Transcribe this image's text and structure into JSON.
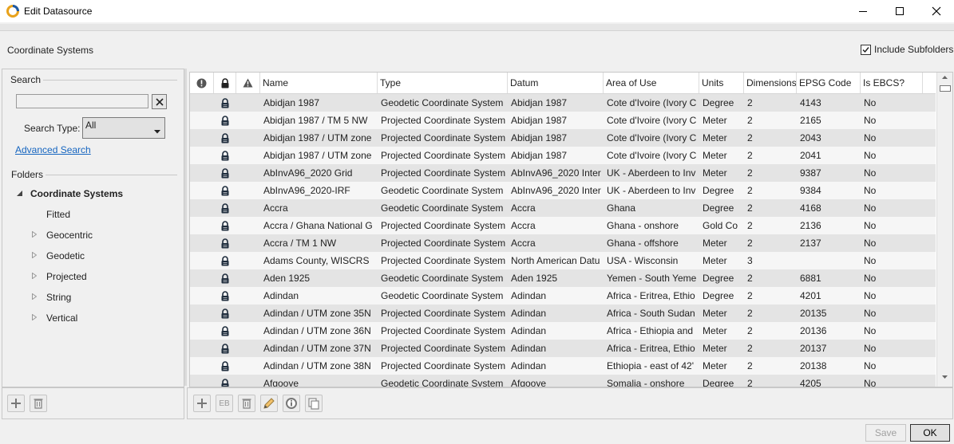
{
  "window": {
    "title": "Edit Datasource",
    "controls": {
      "minimize": "minimize-icon",
      "maximize": "maximize-icon",
      "close": "close-icon"
    }
  },
  "header": {
    "section_title": "Coordinate Systems",
    "include_subfolders": {
      "label": "Include Subfolders",
      "checked": true
    }
  },
  "search": {
    "legend": "Search",
    "input_value": "",
    "search_type_label": "Search Type:",
    "search_type_value": "All",
    "advanced_link": "Advanced Search"
  },
  "folders": {
    "legend": "Folders",
    "root": "Coordinate Systems",
    "children": [
      {
        "label": "Fitted",
        "expandable": false
      },
      {
        "label": "Geocentric",
        "expandable": true
      },
      {
        "label": "Geodetic",
        "expandable": true
      },
      {
        "label": "Projected",
        "expandable": true
      },
      {
        "label": "String",
        "expandable": true
      },
      {
        "label": "Vertical",
        "expandable": true
      }
    ]
  },
  "grid": {
    "columns": {
      "status": "info-icon",
      "lock": "lock-icon",
      "warning": "warning-icon",
      "name": "Name",
      "type": "Type",
      "datum": "Datum",
      "area": "Area of Use",
      "units": "Units",
      "dimensions": "Dimensions",
      "epsg": "EPSG Code",
      "ebcs": "Is EBCS?"
    },
    "rows": [
      {
        "name": "Abidjan 1987",
        "type": "Geodetic Coordinate System",
        "datum": "Abidjan 1987",
        "area": "Cote d'Ivoire (Ivory C",
        "units": "Degree",
        "dimensions": "2",
        "epsg": "4143",
        "ebcs": "No"
      },
      {
        "name": "Abidjan 1987 / TM 5 NW",
        "type": "Projected Coordinate System",
        "datum": "Abidjan 1987",
        "area": "Cote d'Ivoire (Ivory C",
        "units": "Meter",
        "dimensions": "2",
        "epsg": "2165",
        "ebcs": "No"
      },
      {
        "name": "Abidjan 1987 / UTM zone",
        "type": "Projected Coordinate System",
        "datum": "Abidjan 1987",
        "area": "Cote d'Ivoire (Ivory C",
        "units": "Meter",
        "dimensions": "2",
        "epsg": "2043",
        "ebcs": "No"
      },
      {
        "name": "Abidjan 1987 / UTM zone",
        "type": "Projected Coordinate System",
        "datum": "Abidjan 1987",
        "area": "Cote d'Ivoire (Ivory C",
        "units": "Meter",
        "dimensions": "2",
        "epsg": "2041",
        "ebcs": "No"
      },
      {
        "name": "AbInvA96_2020 Grid",
        "type": "Projected Coordinate System",
        "datum": "AbInvA96_2020 Inter",
        "area": "UK - Aberdeen to Inv",
        "units": "Meter",
        "dimensions": "2",
        "epsg": "9387",
        "ebcs": "No"
      },
      {
        "name": "AbInvA96_2020-IRF",
        "type": "Geodetic Coordinate System",
        "datum": "AbInvA96_2020 Inter",
        "area": "UK - Aberdeen to Inv",
        "units": "Degree",
        "dimensions": "2",
        "epsg": "9384",
        "ebcs": "No"
      },
      {
        "name": "Accra",
        "type": "Geodetic Coordinate System",
        "datum": "Accra",
        "area": "Ghana",
        "units": "Degree",
        "dimensions": "2",
        "epsg": "4168",
        "ebcs": "No"
      },
      {
        "name": "Accra / Ghana National G",
        "type": "Projected Coordinate System",
        "datum": "Accra",
        "area": "Ghana - onshore",
        "units": "Gold Co",
        "dimensions": "2",
        "epsg": "2136",
        "ebcs": "No"
      },
      {
        "name": "Accra / TM 1 NW",
        "type": "Projected Coordinate System",
        "datum": "Accra",
        "area": "Ghana - offshore",
        "units": "Meter",
        "dimensions": "2",
        "epsg": "2137",
        "ebcs": "No"
      },
      {
        "name": "Adams County, WISCRS",
        "type": "Projected Coordinate System",
        "datum": "North American Datu",
        "area": "USA - Wisconsin",
        "units": "Meter",
        "dimensions": "3",
        "epsg": "",
        "ebcs": "No"
      },
      {
        "name": "Aden 1925",
        "type": "Geodetic Coordinate System",
        "datum": "Aden 1925",
        "area": "Yemen - South Yeme",
        "units": "Degree",
        "dimensions": "2",
        "epsg": "6881",
        "ebcs": "No"
      },
      {
        "name": "Adindan",
        "type": "Geodetic Coordinate System",
        "datum": "Adindan",
        "area": "Africa - Eritrea, Ethio",
        "units": "Degree",
        "dimensions": "2",
        "epsg": "4201",
        "ebcs": "No"
      },
      {
        "name": "Adindan / UTM zone 35N",
        "type": "Projected Coordinate System",
        "datum": "Adindan",
        "area": "Africa - South Sudan",
        "units": "Meter",
        "dimensions": "2",
        "epsg": "20135",
        "ebcs": "No"
      },
      {
        "name": "Adindan / UTM zone 36N",
        "type": "Projected Coordinate System",
        "datum": "Adindan",
        "area": "Africa - Ethiopia and",
        "units": "Meter",
        "dimensions": "2",
        "epsg": "20136",
        "ebcs": "No"
      },
      {
        "name": "Adindan / UTM zone 37N",
        "type": "Projected Coordinate System",
        "datum": "Adindan",
        "area": "Africa - Eritrea, Ethio",
        "units": "Meter",
        "dimensions": "2",
        "epsg": "20137",
        "ebcs": "No"
      },
      {
        "name": "Adindan / UTM zone 38N",
        "type": "Projected Coordinate System",
        "datum": "Adindan",
        "area": "Ethiopia - east of 42'",
        "units": "Meter",
        "dimensions": "2",
        "epsg": "20138",
        "ebcs": "No"
      },
      {
        "name": "Afgooye",
        "type": "Geodetic Coordinate System",
        "datum": "Afgooye",
        "area": "Somalia - onshore",
        "units": "Degree",
        "dimensions": "2",
        "epsg": "4205",
        "ebcs": "No"
      }
    ]
  },
  "toolbars": {
    "left": [
      "add-icon",
      "delete-icon"
    ],
    "right": [
      {
        "icon": "add-icon",
        "label": ""
      },
      {
        "icon": "ebcs-icon",
        "label": "EB"
      },
      {
        "icon": "delete-icon",
        "label": ""
      },
      {
        "icon": "edit-icon",
        "label": ""
      },
      {
        "icon": "info-icon",
        "label": ""
      },
      {
        "icon": "copy-icon",
        "label": ""
      }
    ]
  },
  "footer": {
    "save_label": "Save",
    "ok_label": "OK"
  }
}
